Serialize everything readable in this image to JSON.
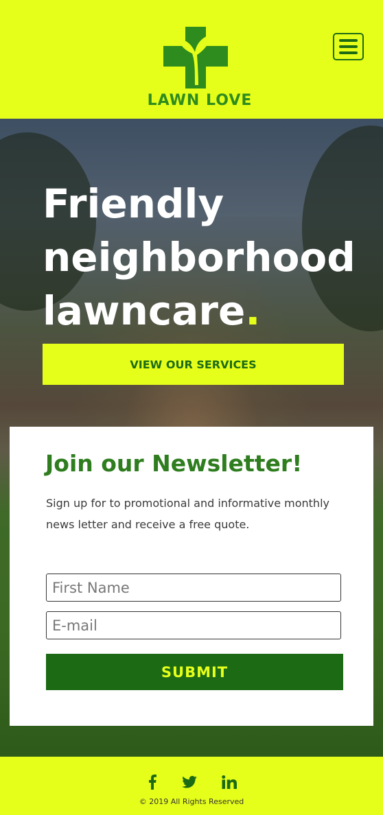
{
  "brand": {
    "name": "LAWN LOVE"
  },
  "header": {
    "menu_icon": "hamburger-menu-icon"
  },
  "hero": {
    "title_line1": "Friendly",
    "title_line2": "neighborhood",
    "title_line3": "lawncare",
    "title_dot": ".",
    "cta_label": "VIEW OUR SERVICES"
  },
  "newsletter": {
    "title": "Join our Newsletter!",
    "description": "Sign up for to promotional and informative monthly news letter and receive a free quote.",
    "first_name_placeholder": "First Name",
    "email_placeholder": "E-mail",
    "submit_label": "SUBMIT"
  },
  "footer": {
    "social_icons": [
      "facebook-icon",
      "twitter-icon",
      "linkedin-icon"
    ],
    "copyright": "© 2019 All Rights Reserved"
  },
  "colors": {
    "accent_yellow": "#e6ff1a",
    "brand_green": "#1c6b14",
    "title_green": "#2e7d1e"
  }
}
